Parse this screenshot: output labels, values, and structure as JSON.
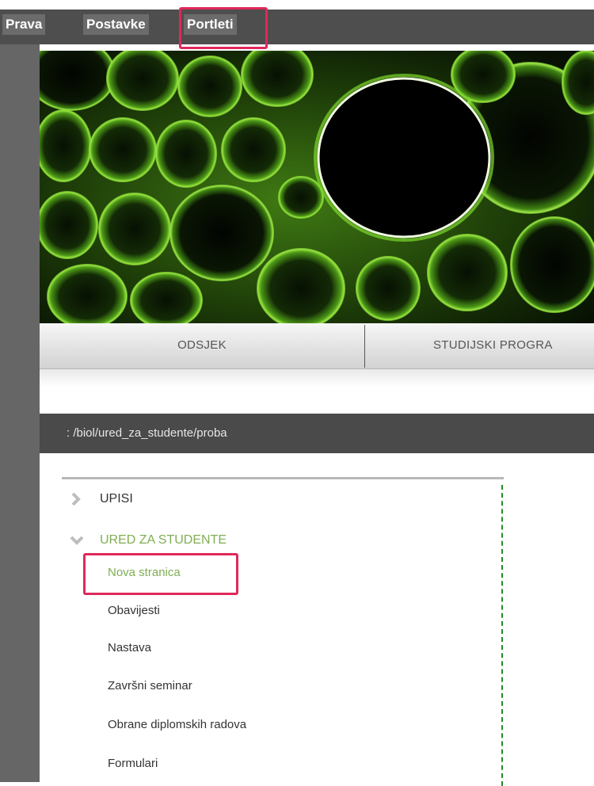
{
  "admin_bar": {
    "tabs": [
      {
        "label": "Prava"
      },
      {
        "label": "Postavke"
      },
      {
        "label": "Portleti",
        "highlighted": true
      }
    ],
    "highlight_color": "#e0285a"
  },
  "banner": {
    "description_icon": "green-cell-pattern-image"
  },
  "main_nav": {
    "items": [
      {
        "label": "ODSJEK"
      },
      {
        "label": "STUDIJSKI PROGRA"
      }
    ]
  },
  "breadcrumb": {
    "path": ": /biol/ured_za_studente/proba"
  },
  "side_menu": {
    "items": [
      {
        "label": "UPISI",
        "icon": "chevron-right-icon",
        "expanded": false
      },
      {
        "label": "URED ZA STUDENTE",
        "icon": "chevron-down-icon",
        "expanded": true,
        "active": true
      }
    ],
    "subitems": [
      {
        "label": "Nova stranica",
        "active": true,
        "highlighted": true
      },
      {
        "label": "Obavijesti"
      },
      {
        "label": "Nastava"
      },
      {
        "label": "Završni seminar"
      },
      {
        "label": "Obrane diplomskih radova"
      },
      {
        "label": "Formulari"
      }
    ],
    "active_color": "#7fae52"
  }
}
